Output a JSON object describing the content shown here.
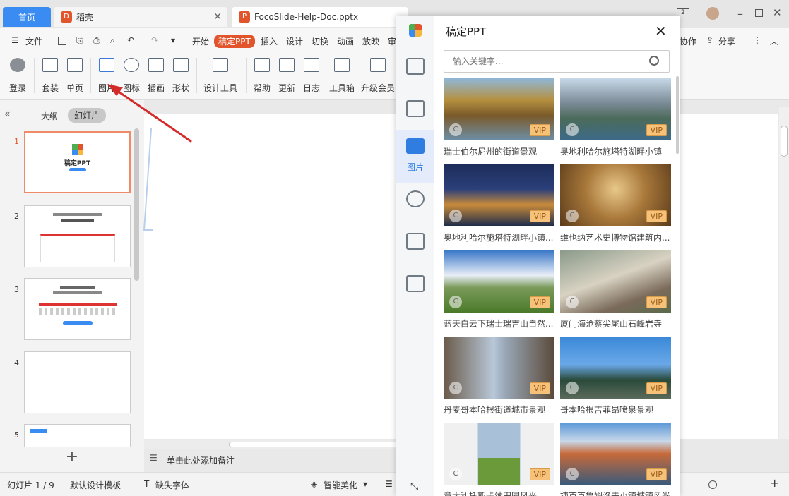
{
  "tabs": [
    {
      "label": "首页"
    },
    {
      "label": "稻壳"
    },
    {
      "label": "FocoSlide-Help-Doc.pptx"
    }
  ],
  "menu": {
    "file": "文件",
    "items": [
      "开始",
      "稿定PPT",
      "插入",
      "设计",
      "切换",
      "动画",
      "放映",
      "审"
    ],
    "collab": "协作",
    "share": "分享"
  },
  "ribbon": {
    "buttons": [
      "登录",
      "套装",
      "单页",
      "图片",
      "图标",
      "插画",
      "形状",
      "设计工具",
      "帮助",
      "更新",
      "日志",
      "工具箱",
      "升级会员"
    ]
  },
  "outline": {
    "tab_outline": "大纲",
    "tab_slides": "幻灯片",
    "slide_numbers": [
      "1",
      "2",
      "3",
      "4",
      "5"
    ],
    "thumb1_title": "稿定PPT",
    "add_label": "+"
  },
  "editor": {
    "notes_placeholder": "单击此处添加备注"
  },
  "status": {
    "slide_count": "幻灯片 1 / 9",
    "template": "默认设计模板",
    "missing_font": "缺失字体",
    "beautify": "智能美化"
  },
  "panel": {
    "title": "稿定PPT",
    "search_placeholder": "输入关键字...",
    "nav_image_label": "图片",
    "vip_label": "VIP",
    "cards": [
      {
        "caption": "瑞士伯尔尼州的街道景观"
      },
      {
        "caption": "奥地利哈尔施塔特湖畔小镇"
      },
      {
        "caption": "奥地利哈尔施塔特湖畔小镇..."
      },
      {
        "caption": "维也纳艺术史博物馆建筑内..."
      },
      {
        "caption": "蓝天白云下瑞士瑞吉山自然..."
      },
      {
        "caption": "厦门海沧蔡尖尾山石峰岩寺"
      },
      {
        "caption": "丹麦哥本哈根街道城市景观"
      },
      {
        "caption": "哥本哈根吉菲昂喷泉景观"
      },
      {
        "caption": "意大利托斯卡纳田园风光..."
      },
      {
        "caption": "捷克克鲁姆洛夫小镇城镇风光"
      }
    ]
  },
  "colors": {
    "accent": "#3b8cf2",
    "brand": "#e2542b",
    "vip": "#f6c27a"
  }
}
